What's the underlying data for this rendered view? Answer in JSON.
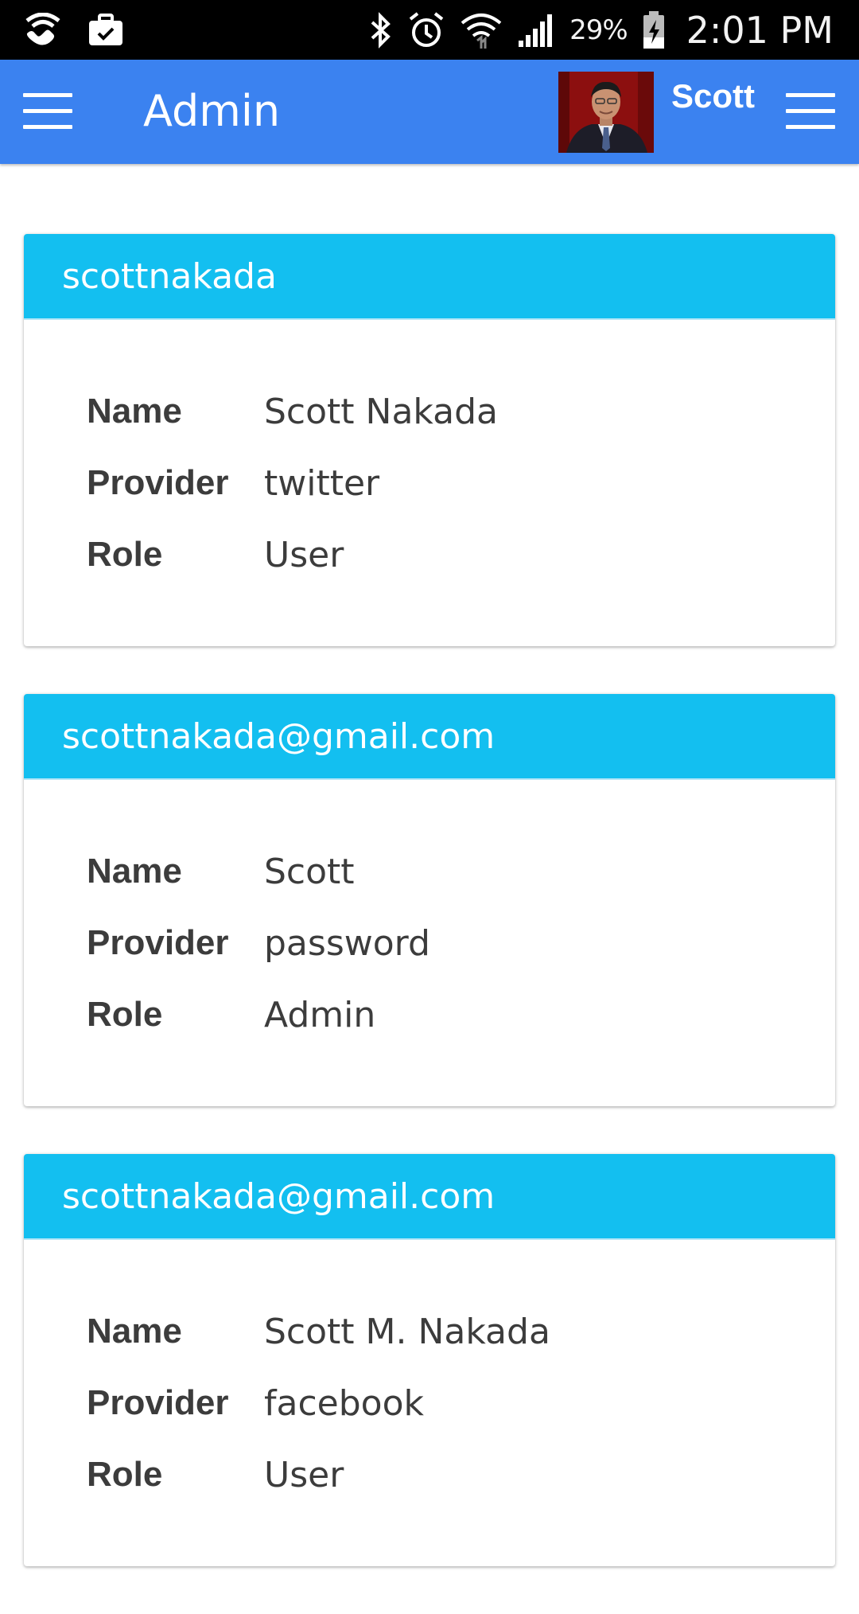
{
  "status_bar": {
    "battery_percent": "29%",
    "time": "2:01 PM",
    "icons": [
      "wifi-calling-icon",
      "work-briefcase-icon",
      "bluetooth-icon",
      "alarm-icon",
      "wifi-icon",
      "signal-icon",
      "battery-charging-icon"
    ]
  },
  "app_bar": {
    "title": "Admin",
    "user_name": "Scott",
    "color": "#3b82f0"
  },
  "card_header_color": "#13bff0",
  "users": [
    {
      "header": "scottnakada",
      "fields": [
        {
          "label": "Name",
          "value": "Scott Nakada"
        },
        {
          "label": "Provider",
          "value": "twitter"
        },
        {
          "label": "Role",
          "value": "User"
        }
      ]
    },
    {
      "header": "scottnakada@gmail.com",
      "fields": [
        {
          "label": "Name",
          "value": "Scott"
        },
        {
          "label": "Provider",
          "value": "password"
        },
        {
          "label": "Role",
          "value": "Admin"
        }
      ]
    },
    {
      "header": "scottnakada@gmail.com",
      "fields": [
        {
          "label": "Name",
          "value": "Scott M. Nakada"
        },
        {
          "label": "Provider",
          "value": "facebook"
        },
        {
          "label": "Role",
          "value": "User"
        }
      ]
    }
  ]
}
